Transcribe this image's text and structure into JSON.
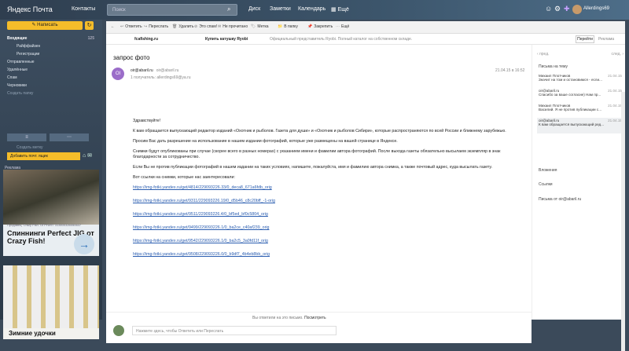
{
  "header": {
    "logo": "Яндекс Почта",
    "contacts": "Контакты",
    "search_placeholder": "Поиск",
    "nav": [
      "Диск",
      "Заметки",
      "Календарь",
      "Ещё"
    ],
    "username": "Allerdings69"
  },
  "sidebar": {
    "compose": "Написать",
    "folders": [
      {
        "label": "Входящие",
        "count": "125",
        "cls": "active"
      },
      {
        "label": "Райффайзен",
        "count": "",
        "cls": "sub"
      },
      {
        "label": "Регистрации",
        "count": "",
        "cls": "sub"
      },
      {
        "label": "Отправленные",
        "count": "",
        "cls": ""
      },
      {
        "label": "Удалённые",
        "count": "",
        "cls": ""
      },
      {
        "label": "Спам",
        "count": "",
        "cls": ""
      },
      {
        "label": "Черновики",
        "count": "",
        "cls": ""
      },
      {
        "label": "Создать папку",
        "count": "",
        "cls": "dim"
      }
    ],
    "create_label": "Создать метку",
    "add_box": "Добавить почт. ящик",
    "ad_label": "Реклама",
    "ad1": {
      "caption": "Продавец: Crazy Fish. ОГРНИП: 313500326050637",
      "title": "Спиннинги Perfect JIG от Crazy Fish!"
    },
    "ad2": {
      "title": "Зимние удочки"
    }
  },
  "toolbar": [
    "Ответить",
    "Переслать",
    "Удалить",
    "Это спам!",
    "Не прочитано",
    "Метка",
    "В папку",
    "Закрепить",
    "Ещё"
  ],
  "adrow": {
    "source": "fcafishing.ru",
    "title": "Купить катушку Ryobi",
    "desc": "Официальный представитель Ryobi. Полный каталог на собственном складе.",
    "go": "Перейти",
    "label": "Реклама"
  },
  "message": {
    "subject": "запрос фото",
    "avatar": "OI",
    "sender": "oir@abaril.ru",
    "sender_addr": "oir@abaril.ru",
    "recipient": "1 получатель: allerdings69@ya.ru",
    "date": "21.04.15 в 16:52",
    "greeting": "Здравствуйте!",
    "p1": "К вам обращается выпускающий редактор изданий «Охотник и рыболов. Газета для души» и «Охотник и рыболов Сибири», которые распространяются по всей России и ближнему зарубежью.",
    "p2": "Просим Вас дать разрешение на использование в нашем издании фотографий, которые уже размещены на вашей странице в Яндексе.",
    "p3": "Снимки будут опубликованы при случае (скорее всего в разных номерах) с указанием имени и фамилии автора фотографий. После выхода газеты обязательно высылаем экземпляр в знак благодарности за сотрудничество.",
    "p4": "Если Вы не против публикации фотографий в нашем издании на таких условиях, напишите, пожалуйста, имя и фамилию автора снимка, а также почтовый адрес, куда высылать газету.",
    "p5": "Вот ссылки на снимки, которые нас заинтересовали:",
    "links": [
      "https://img-fotki.yandex.ru/get/4814/229093226.33/0_deca8_671a6fdb_orig",
      "https://img-fotki.yandex.ru/get/9311/229093226.19/0_d5b46_c8c20bff_-1-orig",
      "https://img-fotki.yandex.ru/get/9511/229093226.4/0_bf5ed_bf0c5804_orig",
      "https://img-fotki.yandex.ru/get/9499/229093226.1/0_ba2ce_c40af239_orig",
      "https://img-fotki.yandex.ru/get/9542/229093226.1/0_ba2c5_3a0fd11f_orig",
      "https://img-fotki.yandex.ru/get/9508/229093226.0/0_b9df7_4b4eb8bb_orig"
    ]
  },
  "reply": {
    "note": "Вы ответили на это письмо.",
    "note_link": "Посмотреть",
    "placeholder": "Нажмите здесь, чтобы Ответить или Переслать"
  },
  "thread": {
    "prev": "пред.",
    "next": "след.",
    "title": "Письма на тему",
    "items": [
      {
        "from": "Михаил Плотчиков",
        "date": "21.04.15",
        "text": "Значит на том и остановимся - если..."
      },
      {
        "from": "oir@abaril.ru",
        "date": "21.04.15",
        "text": "Спасибо за ваше согласие) Нам пр..."
      },
      {
        "from": "Михаил Плотчиков",
        "date": "21.04.15",
        "text": "Василий. Я не против публикации с..."
      },
      {
        "from": "oir@abaril.ru",
        "date": "21.04.15",
        "text": "К вам обращается выпускающий ред..."
      }
    ],
    "attachments": "Вложения",
    "links": "Ссылки",
    "from_sender": "Письма от oir@abaril.ru"
  }
}
